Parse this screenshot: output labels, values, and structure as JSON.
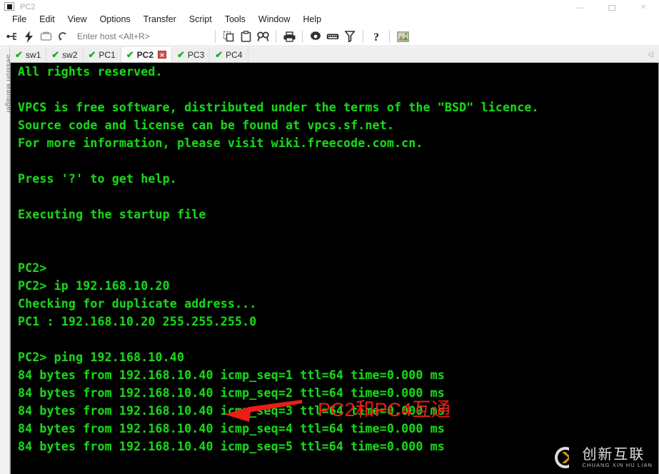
{
  "window": {
    "title": "PC2",
    "icon": "terminal-window-icon",
    "controls": {
      "minimize": "—",
      "maximize": "□",
      "close": "✕"
    }
  },
  "menubar": {
    "items": [
      {
        "label": "File"
      },
      {
        "label": "Edit"
      },
      {
        "label": "View"
      },
      {
        "label": "Options"
      },
      {
        "label": "Transfer"
      },
      {
        "label": "Script"
      },
      {
        "label": "Tools"
      },
      {
        "label": "Window"
      },
      {
        "label": "Help"
      }
    ]
  },
  "toolbar": {
    "host_placeholder": "Enter host <Alt+R>",
    "host_value": "",
    "buttons": [
      {
        "name": "connect-icon",
        "title": "Connect"
      },
      {
        "name": "quick-connect-icon",
        "title": "Quick Connect"
      },
      {
        "name": "connect-in-tab-icon",
        "title": "Connect in Tab"
      },
      {
        "name": "reconnect-icon",
        "title": "Reconnect"
      },
      {
        "name": "copy-icon",
        "title": "Copy"
      },
      {
        "name": "paste-icon",
        "title": "Paste"
      },
      {
        "name": "find-icon",
        "title": "Find"
      },
      {
        "name": "print-icon",
        "title": "Print"
      },
      {
        "name": "settings-gear-icon",
        "title": "Session Options"
      },
      {
        "name": "keyboard-icon",
        "title": "Keymap Editor"
      },
      {
        "name": "filter-icon",
        "title": "Filter"
      },
      {
        "name": "help-icon",
        "title": "Help"
      },
      {
        "name": "capture-icon",
        "title": "Screen Capture"
      }
    ]
  },
  "sidebar": {
    "label": "Session Manager"
  },
  "tabs": {
    "scroll_left_icon": "◁",
    "items": [
      {
        "label": "sw1",
        "active": false,
        "status": "connected"
      },
      {
        "label": "sw2",
        "active": false,
        "status": "connected"
      },
      {
        "label": "PC1",
        "active": false,
        "status": "connected"
      },
      {
        "label": "PC2",
        "active": true,
        "status": "connected",
        "close_glyph": "✕"
      },
      {
        "label": "PC3",
        "active": false,
        "status": "connected"
      },
      {
        "label": "PC4",
        "active": false,
        "status": "connected"
      }
    ]
  },
  "terminal": {
    "foreground_color": "#1ad41a",
    "background_color": "#000000",
    "lines": [
      "All rights reserved.",
      "",
      "VPCS is free software, distributed under the terms of the \"BSD\" licence.",
      "Source code and license can be found at vpcs.sf.net.",
      "For more information, please visit wiki.freecode.com.cn.",
      "",
      "Press '?' to get help.",
      "",
      "Executing the startup file",
      "",
      "",
      "PC2>",
      "PC2> ip 192.168.10.20",
      "Checking for duplicate address...",
      "PC1 : 192.168.10.20 255.255.255.0",
      "",
      "PC2> ping 192.168.10.40",
      "84 bytes from 192.168.10.40 icmp_seq=1 ttl=64 time=0.000 ms",
      "84 bytes from 192.168.10.40 icmp_seq=2 ttl=64 time=0.000 ms",
      "84 bytes from 192.168.10.40 icmp_seq=3 ttl=64 time=0.000 ms",
      "84 bytes from 192.168.10.40 icmp_seq=4 ttl=64 time=0.000 ms",
      "84 bytes from 192.168.10.40 icmp_seq=5 ttl=64 time=0.000 ms"
    ]
  },
  "annotation": {
    "text": "PC2和PC4互通",
    "color": "#ee1c17",
    "arrow_direction": "left"
  },
  "watermark": {
    "name_cn": "创新互联",
    "name_en": "CHUANG XIN HU LIAN",
    "logo": "cx-logo-icon"
  }
}
